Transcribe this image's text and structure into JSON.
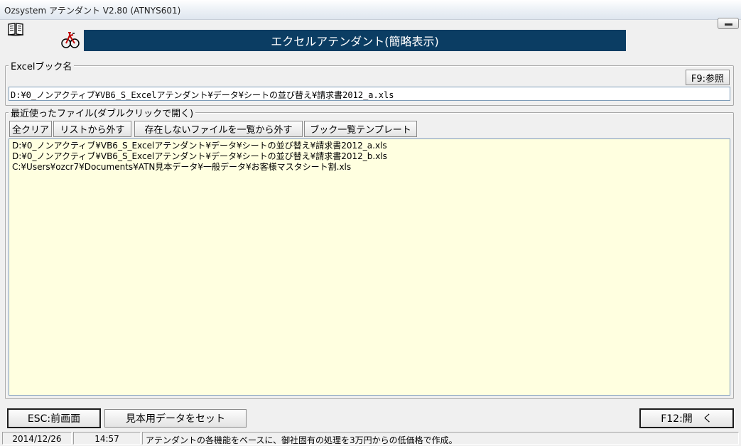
{
  "window": {
    "title": "Ozsystem アテンダント V2.80 (ATNYS601)"
  },
  "icons": {
    "book": "book-icon",
    "bicycle": "bicycle-icon",
    "minimize": "minimize-icon"
  },
  "banner": {
    "text": "エクセルアテンダント(簡略表示)",
    "background": "#0b3d63"
  },
  "excel_book": {
    "label": "Excelブック名",
    "browse_label": "F9:参照",
    "path_value": "D:¥0_ノンアクティブ¥VB6_S_Excelアテンダント¥データ¥シートの並び替え¥請求書2012_a.xls"
  },
  "recent_files": {
    "label": "最近使ったファイル(ダブルクリックで開く)",
    "buttons": {
      "clear_all": "全クリア",
      "remove_from_list": "リストから外す",
      "remove_missing": "存在しないファイルを一覧から外す",
      "book_list_template": "ブック一覧テンプレート"
    },
    "items": [
      "D:¥0_ノンアクティブ¥VB6_S_Excelアテンダント¥データ¥シートの並び替え¥請求書2012_a.xls",
      "D:¥0_ノンアクティブ¥VB6_S_Excelアテンダント¥データ¥シートの並び替え¥請求書2012_b.xls",
      "C:¥Users¥ozcr7¥Documents¥ATN見本データ¥一般データ¥お客様マスタシート割.xls"
    ],
    "list_background": "#ffffe0"
  },
  "footer": {
    "esc_label": "ESC:前画面",
    "sample_label": "見本用データをセット",
    "open_label": "F12:開　く"
  },
  "status": {
    "date": "2014/12/26",
    "time": "14:57",
    "message": "アテンダントの各機能をベースに、御社固有の処理を3万円からの低価格で作成。"
  }
}
